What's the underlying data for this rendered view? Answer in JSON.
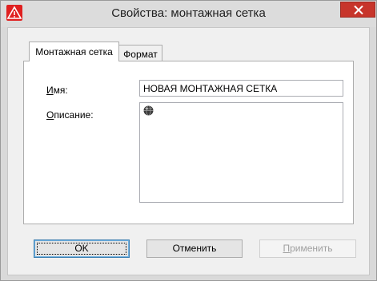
{
  "window": {
    "title": "Свойства: монтажная сетка",
    "icon": "autocad-warning-icon"
  },
  "tabs": [
    {
      "label": "Монтажная сетка",
      "active": true
    },
    {
      "label": "Формат",
      "active": false
    }
  ],
  "form": {
    "name_label_hotkey": "И",
    "name_label_rest": "мя:",
    "name_value": "НОВАЯ МОНТАЖНАЯ СЕТКА",
    "desc_label_hotkey": "О",
    "desc_label_rest": "писание:",
    "desc_icon": "globe-icon"
  },
  "buttons": {
    "ok": "OK",
    "cancel": "Отменить",
    "apply_hotkey": "П",
    "apply_rest": "рименить"
  }
}
